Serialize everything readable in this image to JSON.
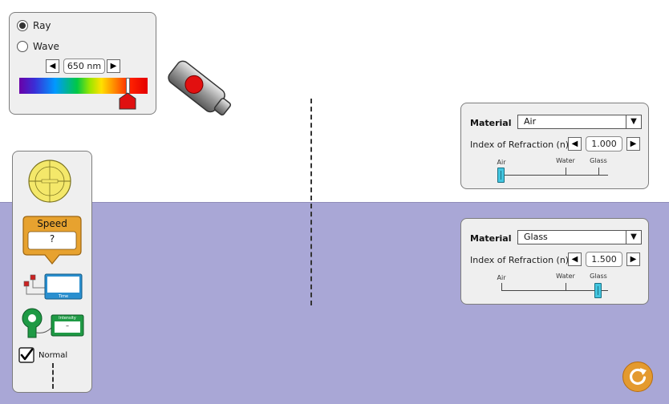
{
  "colors": {
    "upper_medium": "#ffffff",
    "lower_medium": "#a9a7d6",
    "accent": "#e49a2f"
  },
  "light_source": {
    "ray_label": "Ray",
    "wave_label": "Wave",
    "selected_mode": "Ray",
    "wavelength": "650 nm",
    "decrement_icon": "triangle-left-icon",
    "increment_icon": "triangle-right-icon"
  },
  "toolbox": {
    "speed_title": "Speed",
    "speed_value": "?",
    "time_label": "Time",
    "intensity_label": "Intensity",
    "intensity_value": "–",
    "normal_label": "Normal",
    "normal_checked": true
  },
  "top_material": {
    "title": "Material",
    "selected": "Air",
    "ior_label": "Index of Refraction (n)",
    "ior_value": "1.000",
    "ticks": [
      "Air",
      "Water",
      "Glass"
    ],
    "slider_position": "Air"
  },
  "bottom_material": {
    "title": "Material",
    "selected": "Glass",
    "ior_label": "Index of Refraction (n)",
    "ior_value": "1.500",
    "ticks": [
      "Air",
      "Water",
      "Glass"
    ],
    "slider_position": "Glass"
  },
  "reset_icon": "reset-icon"
}
